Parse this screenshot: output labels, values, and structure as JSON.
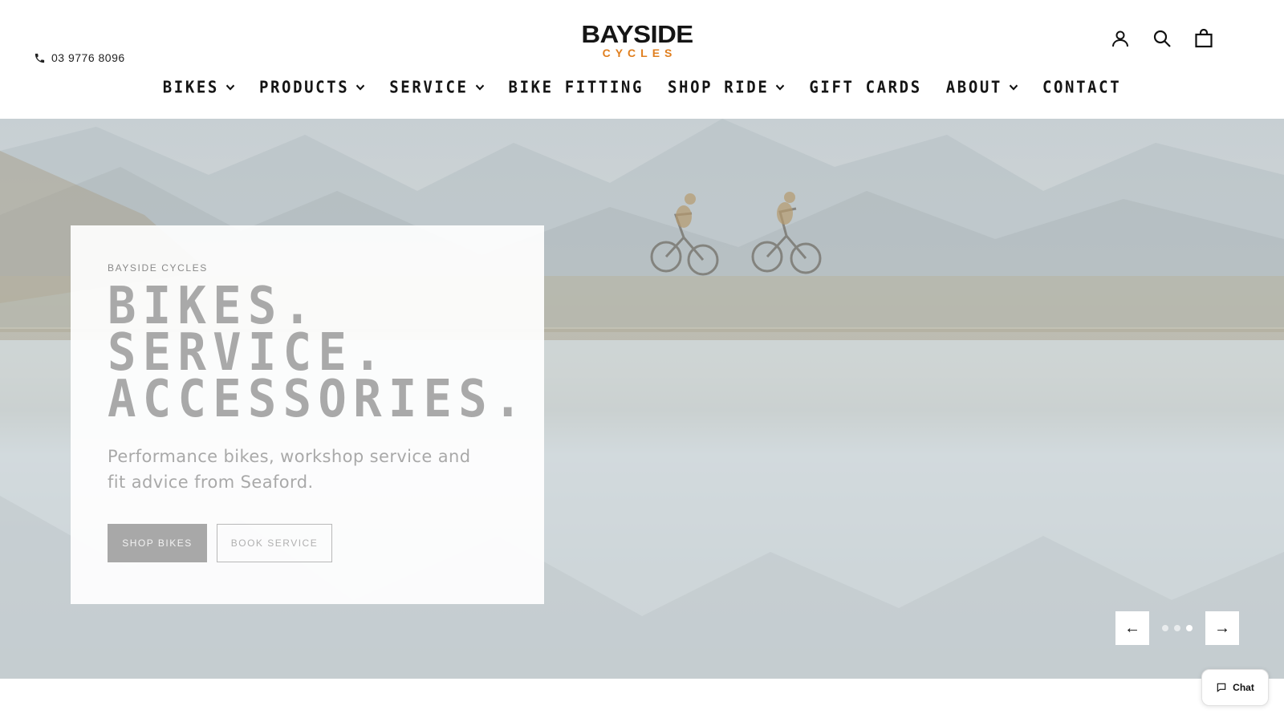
{
  "header": {
    "phone": "03 9776 8096",
    "logo": {
      "main": "BAYSIDE",
      "sub": "CYCLES",
      "sub_color": "#e07f1f"
    },
    "icons": [
      "account-icon",
      "search-icon",
      "cart-icon"
    ]
  },
  "nav": {
    "items": [
      {
        "label": "BIKES",
        "dropdown": true
      },
      {
        "label": "PRODUCTS",
        "dropdown": true
      },
      {
        "label": "SERVICE",
        "dropdown": true
      },
      {
        "label": "BIKE FITTING",
        "dropdown": false
      },
      {
        "label": "SHOP RIDE",
        "dropdown": true
      },
      {
        "label": "GIFT CARDS",
        "dropdown": false
      },
      {
        "label": "ABOUT",
        "dropdown": true
      },
      {
        "label": "CONTACT",
        "dropdown": false
      }
    ]
  },
  "hero": {
    "eyebrow": "BAYSIDE CYCLES",
    "headline": [
      "BIKES.",
      "SERVICE.",
      "ACCESSORIES."
    ],
    "subtext": "Performance bikes, workshop service and fit advice from Seaford.",
    "primary_button": "SHOP BIKES",
    "secondary_button": "BOOK SERVICE",
    "prev_label": "←",
    "next_label": "→",
    "slides_count": 3,
    "active_slide": 3
  },
  "chat": {
    "label": "Chat"
  }
}
